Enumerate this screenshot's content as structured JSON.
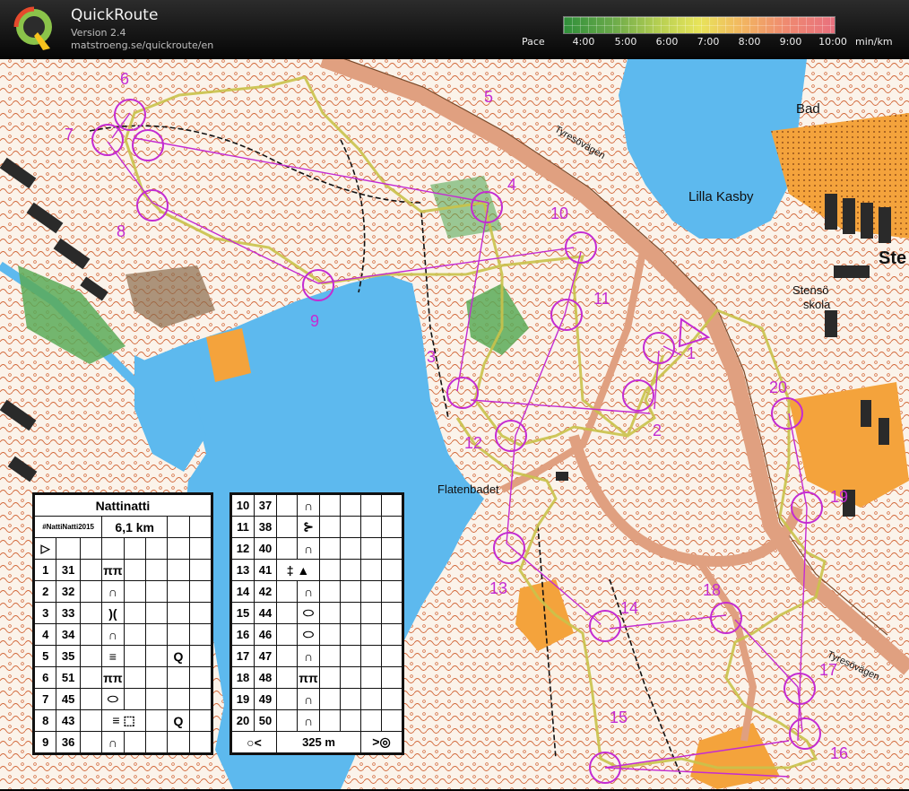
{
  "app": {
    "name": "QuickRoute",
    "version": "Version 2.4",
    "url": "matstroeng.se/quickroute/en"
  },
  "pace": {
    "label": "Pace",
    "unit": "min/km",
    "ticks": [
      "4:00",
      "5:00",
      "6:00",
      "7:00",
      "8:00",
      "9:00",
      "10:00"
    ],
    "colors": [
      "#2f8f3a",
      "#b6cf52",
      "#e8e45a",
      "#f2b860",
      "#e8707e"
    ]
  },
  "map": {
    "place_names": {
      "bad": "Bad",
      "lilla_kasby": "Lilla Kasby",
      "tyresovagen_top": "Tyresövägen",
      "tyresovagen_bottom": "Tyresövägen",
      "stenso_skola_1": "Stensö",
      "stenso_skola_2": "skola",
      "flatenbadet": "Flatenbadet",
      "ste": "Ste"
    },
    "controls": [
      "1",
      "2",
      "3",
      "4",
      "5",
      "6",
      "7",
      "8",
      "9",
      "10",
      "11",
      "12",
      "13",
      "14",
      "15",
      "16",
      "17",
      "18",
      "19",
      "20"
    ],
    "colors": {
      "water": "#5db9ee",
      "land": "#fbf3ea",
      "contour": "#c4582a",
      "course": "#c42bd2",
      "road": "#e0a080",
      "track": "#2d7a2a",
      "building": "#2a2a2a",
      "open": "#f4a33c",
      "green": "#5aaa58"
    }
  },
  "description": {
    "title": "Nattinatti",
    "event": "#NattiNatti2015",
    "length": "6,1 km",
    "start_symbol": "▷",
    "left_rows": [
      {
        "no": "1",
        "code": "31",
        "sym": "ππ",
        "extra": ""
      },
      {
        "no": "2",
        "code": "32",
        "sym": "∩",
        "extra": ""
      },
      {
        "no": "3",
        "code": "33",
        "sym": ")(",
        "extra": ""
      },
      {
        "no": "4",
        "code": "34",
        "sym": "∩",
        "extra": ""
      },
      {
        "no": "5",
        "code": "35",
        "sym": "≡",
        "extra": "Q"
      },
      {
        "no": "6",
        "code": "51",
        "sym": "ππ",
        "extra": ""
      },
      {
        "no": "7",
        "code": "45",
        "sym": "⬭",
        "extra": ""
      },
      {
        "no": "8",
        "code": "43",
        "sym": "≡ ⬚",
        "extra": "Q"
      },
      {
        "no": "9",
        "code": "36",
        "sym": "∩",
        "extra": ""
      }
    ],
    "right_rows": [
      {
        "no": "10",
        "code": "37",
        "sym": "∩"
      },
      {
        "no": "11",
        "code": "38",
        "sym": "⊱"
      },
      {
        "no": "12",
        "code": "40",
        "sym": "∩"
      },
      {
        "no": "13",
        "code": "41",
        "sym": "‡ ▲"
      },
      {
        "no": "14",
        "code": "42",
        "sym": "∩"
      },
      {
        "no": "15",
        "code": "44",
        "sym": "⬭"
      },
      {
        "no": "16",
        "code": "46",
        "sym": "⬭"
      },
      {
        "no": "17",
        "code": "47",
        "sym": "∩"
      },
      {
        "no": "18",
        "code": "48",
        "sym": "ππ"
      },
      {
        "no": "19",
        "code": "49",
        "sym": "∩"
      },
      {
        "no": "20",
        "code": "50",
        "sym": "∩"
      }
    ],
    "finish": {
      "left": "○<",
      "distance": "325 m",
      "right": ">◎"
    }
  }
}
